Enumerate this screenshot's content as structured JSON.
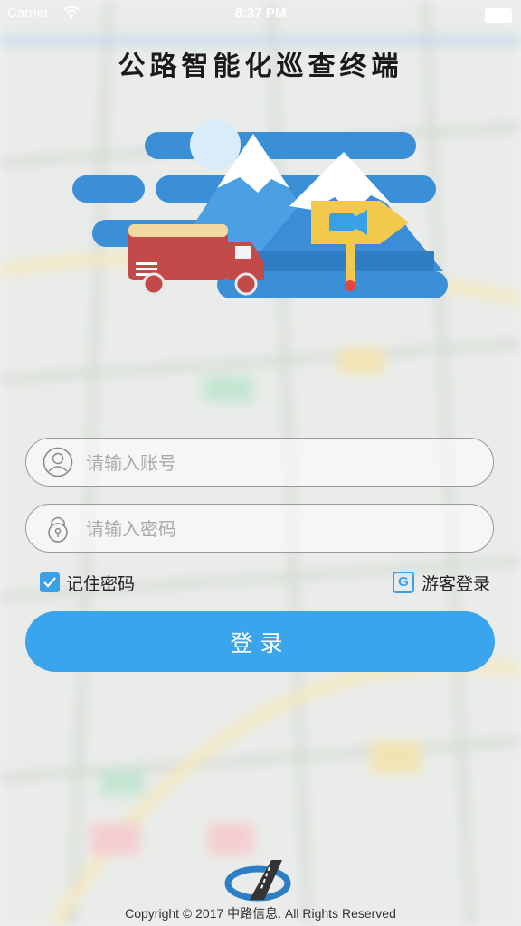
{
  "status_bar": {
    "carrier": "Carrier",
    "time": "8:37 PM"
  },
  "app_title": "公路智能化巡查终端",
  "login_form": {
    "account_placeholder": "请输入账号",
    "password_placeholder": "请输入密码",
    "account_value": "",
    "password_value": "",
    "remember_label": "记住密码",
    "remember_checked": true,
    "guest_icon_letter": "G",
    "guest_label": "游客登录",
    "login_label": "登录"
  },
  "footer": {
    "copyright": "Copyright © 2017 中路信息. All Rights Reserved"
  },
  "colors": {
    "accent": "#3aa5ec",
    "truck": "#c44a49",
    "mountain": "#3b8fd6",
    "sign": "#f2c94c"
  },
  "icons": {
    "account": "user-icon",
    "password": "lock-icon",
    "remember": "checkbox-icon",
    "guest": "guest-g-icon"
  }
}
